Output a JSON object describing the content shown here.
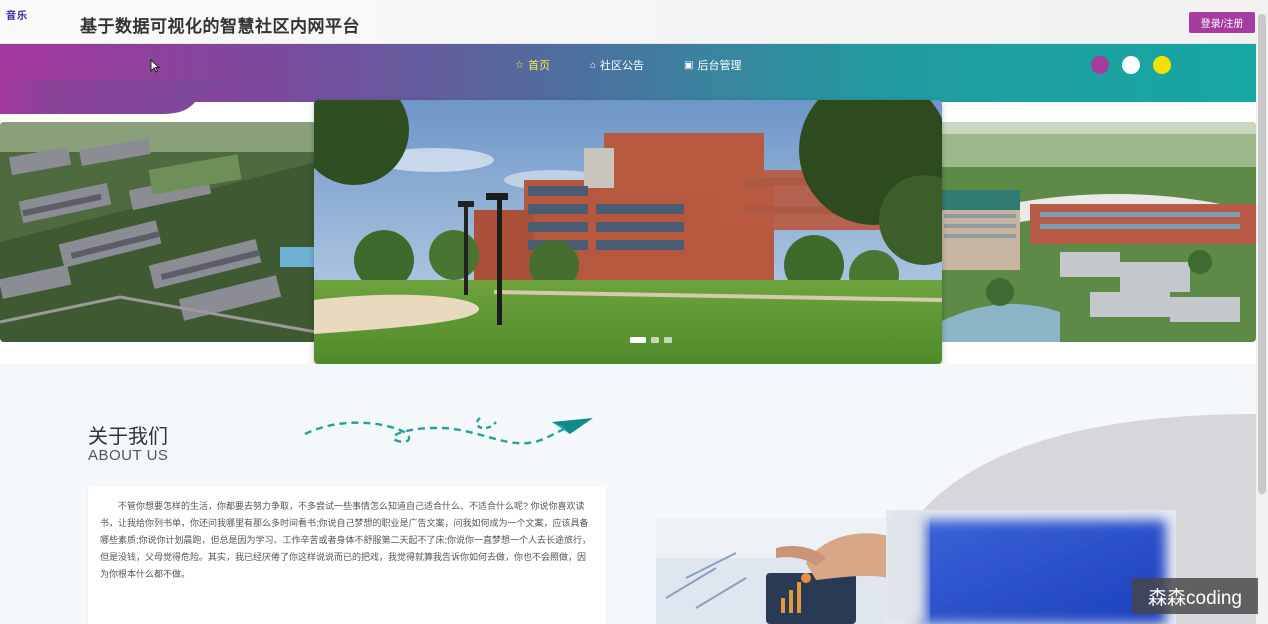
{
  "header": {
    "music_label": "音乐",
    "site_title": "基于数据可视化的智慧社区内网平台",
    "login_label": "登录/注册"
  },
  "nav": {
    "items": [
      {
        "label": "首页",
        "icon": "star-icon",
        "active": true
      },
      {
        "label": "社区公告",
        "icon": "bag-icon",
        "active": false
      },
      {
        "label": "后台管理",
        "icon": "archive-icon",
        "active": false
      }
    ],
    "theme_dots": [
      "#a63c9f",
      "#ffffff",
      "#f5e000"
    ]
  },
  "carousel": {
    "slides": 3,
    "active_index": 0
  },
  "about": {
    "title_cn": "关于我们",
    "title_en": "ABOUT US",
    "body": "不管你想要怎样的生活，你都要去努力争取，不多尝试一些事情怎么知道自己适合什么、不适合什么呢? 你说你喜欢读书，让我给你列书单，你还问我哪里有那么多时间看书;你说自己梦想的职业是广告文案，问我如何成为一个文案，应该具备哪些素质;你说你计划晨跑，但总是因为学习、工作辛苦或者身体不舒服第二天起不了床;你说你一直梦想一个人去长途旅行，但是没钱，父母觉得危险。其实，我已经厌倦了你这样说说而已的把戏，我觉得就算我告诉你如何去做，你也不会照做，因为你根本什么都不做。"
  },
  "watermark": "森森coding",
  "colors": {
    "accent": "#a63c9f",
    "teal": "#16a7a3",
    "active_nav": "#f7e94a"
  }
}
